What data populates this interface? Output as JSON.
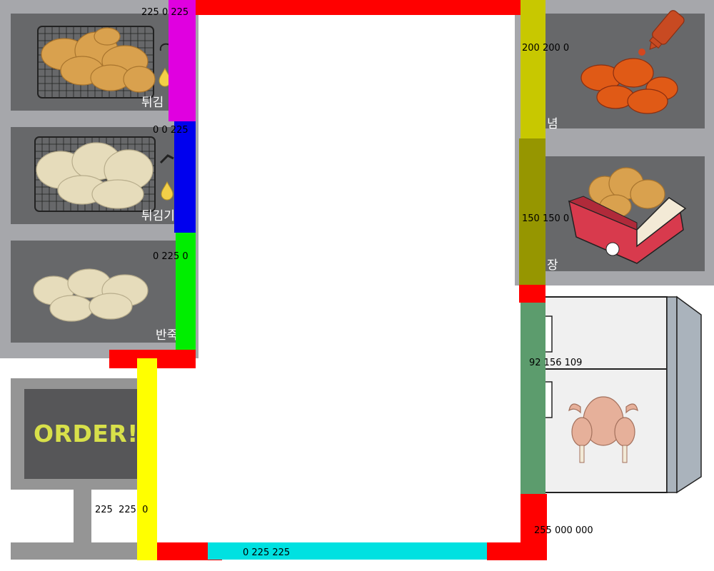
{
  "stations": {
    "fry_done_label": "튀김",
    "fry_ready_label": "튀김기",
    "dough_label": "반죽",
    "seasoning_label": "념",
    "packing_label": "장"
  },
  "order_board": {
    "text": "ORDER!!"
  },
  "walls": {
    "magenta": {
      "rgb": "225 0 225",
      "color": "#e000e0"
    },
    "blue": {
      "rgb": "0 0 225",
      "color": "#0000ee"
    },
    "green": {
      "rgb": "0 225 0",
      "color": "#00ee00"
    },
    "yellow": {
      "rgb": "225  225  0",
      "color": "#ffff00"
    },
    "olive_light": {
      "rgb": "200 200 0",
      "color": "#c8c800"
    },
    "olive_dark": {
      "rgb": "150 150 0",
      "color": "#969600"
    },
    "seagreen": {
      "rgb": "92 156 109",
      "color": "#5c9c6d"
    },
    "cyan": {
      "rgb": "0 225 225",
      "color": "#00e1e1"
    },
    "red": {
      "rgb": "255 000 000",
      "color": "#ff0000"
    }
  },
  "icons": [
    "fried-chicken-icon",
    "raw-chicken-icon",
    "dough-icon",
    "sauce-bottle-icon",
    "seasoned-chicken-icon",
    "chicken-box-icon",
    "whole-chicken-icon",
    "refrigerator-icon",
    "oil-drop-icon"
  ]
}
